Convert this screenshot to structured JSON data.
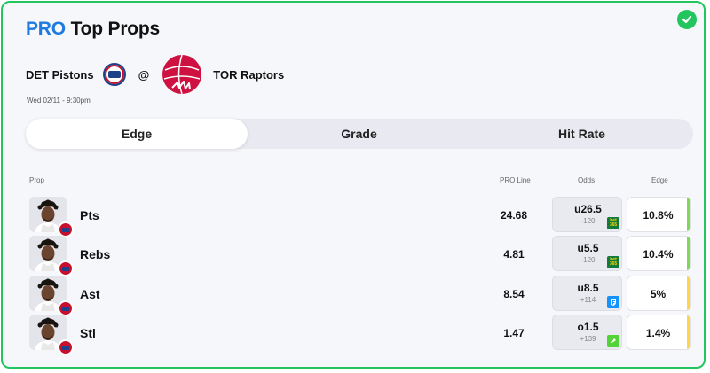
{
  "header": {
    "title_pro": "PRO",
    "title_rest": "Top Props",
    "status": "check-circle-icon"
  },
  "game": {
    "home_team": "DET Pistons",
    "at": "@",
    "away_team": "TOR Raptors",
    "datetime": "Wed 02/11 - 9:30pm"
  },
  "tabs": [
    {
      "label": "Edge",
      "active": true
    },
    {
      "label": "Grade",
      "active": false
    },
    {
      "label": "Hit Rate",
      "active": false
    }
  ],
  "columns": {
    "prop": "Prop",
    "pro_line": "PRO Line",
    "odds": "Odds",
    "edge": "Edge"
  },
  "rows": [
    {
      "stat": "Pts",
      "pro_line": "24.68",
      "odds_line": "u26.5",
      "odds_price": "-120",
      "book": "bet365",
      "book_label": "bet 365",
      "edge": "10.8%",
      "edge_color": "#7ed957"
    },
    {
      "stat": "Rebs",
      "pro_line": "4.81",
      "odds_line": "u5.5",
      "odds_price": "-120",
      "book": "bet365",
      "book_label": "bet 365",
      "edge": "10.4%",
      "edge_color": "#7ed957"
    },
    {
      "stat": "Ast",
      "pro_line": "8.54",
      "odds_line": "u8.5",
      "odds_price": "+114",
      "book": "fanduel",
      "book_label": "",
      "edge": "5%",
      "edge_color": "#ffd54a"
    },
    {
      "stat": "Stl",
      "pro_line": "1.47",
      "odds_line": "o1.5",
      "odds_price": "+139",
      "book": "draftkings",
      "book_label": "",
      "edge": "1.4%",
      "edge_color": "#ffd54a"
    }
  ],
  "colors": {
    "accent": "#1f7ae0",
    "border": "#22c55e",
    "high_edge": "#7ed957",
    "mid_edge": "#ffd54a"
  }
}
